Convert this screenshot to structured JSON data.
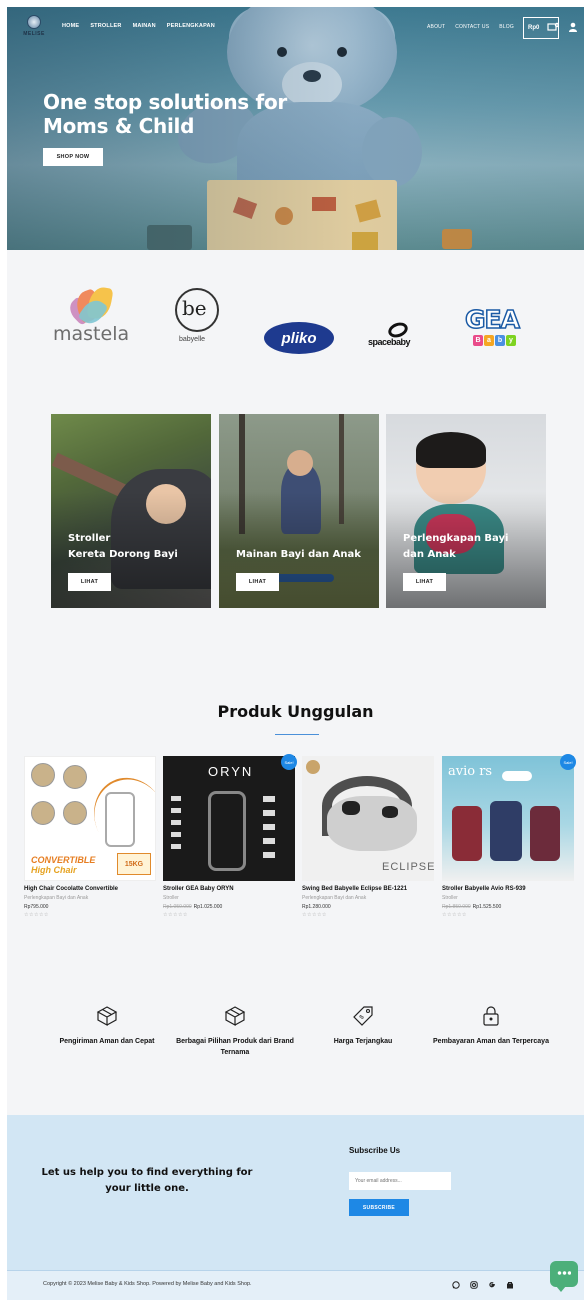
{
  "nav": {
    "logo_text": "MELISE",
    "left_items": [
      "HOME",
      "STROLLER",
      "MAINAN",
      "PERLENGKAPAN"
    ],
    "right_items": [
      "ABOUT",
      "CONTACT US",
      "BLOG"
    ],
    "cart_total": "Rp0",
    "cart_count": "0",
    "icons": [
      "cart-icon",
      "user-icon"
    ]
  },
  "hero": {
    "title": "One stop solutions for Moms & Child",
    "button": "SHOP NOW"
  },
  "brands": {
    "mastela": "mastela",
    "babyelle_mark": "be",
    "babyelle": "babyelle",
    "pliko": "pliko",
    "spacebaby": "spacebaby",
    "gea": "GEA",
    "gea_baby": [
      "B",
      "a",
      "b",
      "y"
    ]
  },
  "categories": [
    {
      "title": "Stroller\nKereta Dorong Bayi",
      "button": "LIHAT"
    },
    {
      "title": "Mainan Bayi dan Anak",
      "button": "LIHAT"
    },
    {
      "title": "Perlengkapan Bayi dan Anak",
      "button": "LIHAT"
    }
  ],
  "featured": {
    "title": "Produk Unggulan",
    "products": [
      {
        "name": "High Chair Cocolatte Convertible",
        "category": "Perlengkapan Bayi dan Anak",
        "old_price": "",
        "price": "Rp795.000",
        "stars": "☆☆☆☆☆",
        "sale": "",
        "image_text": [
          "CONVERTIBLE",
          "High Chair",
          "15KG"
        ]
      },
      {
        "name": "Stroller GEA Baby ORYN",
        "category": "Stroller",
        "old_price": "Rp1.050.000",
        "price": "Rp1.025.000",
        "stars": "☆☆☆☆☆",
        "sale": "Sale!",
        "image_text": [
          "ORYN"
        ]
      },
      {
        "name": "Swing Bed Babyelle Eclipse BE-1221",
        "category": "Perlengkapan Bayi dan Anak",
        "old_price": "",
        "price": "Rp1.280.000",
        "stars": "☆☆☆☆☆",
        "sale": "",
        "image_text": [
          "ECLIPSE"
        ]
      },
      {
        "name": "Stroller Babyelle Avio RS-939",
        "category": "Stroller",
        "old_price": "Rp1.850.000",
        "price": "Rp1.525.500",
        "stars": "☆☆☆☆☆",
        "sale": "Sale!",
        "image_text": [
          "avio rs"
        ]
      }
    ]
  },
  "features": [
    {
      "icon": "box-icon",
      "label": "Pengiriman Aman dan Cepat"
    },
    {
      "icon": "box-icon",
      "label": "Berbagai Pilihan Produk dari Brand Ternama"
    },
    {
      "icon": "price-tag-icon",
      "label": "Harga Terjangkau"
    },
    {
      "icon": "lock-icon",
      "label": "Pembayaran Aman dan Terpercaya"
    }
  ],
  "subscribe": {
    "lead": "Let us help you to find everything for your little one.",
    "title": "Subscribe Us",
    "placeholder": "Your email address...",
    "button": "SUBSCRIBE"
  },
  "footer": {
    "copyright": "Copyright © 2023 Melise Baby & Kids Shop. Powered by Melise Baby and Kids Shop.",
    "social_icons": [
      "whatsapp-icon",
      "instagram-icon",
      "google-icon",
      "shop-icon"
    ],
    "chat_icon": "chat-icon"
  },
  "colors": {
    "accent": "#1e88e5",
    "subscribe_bg": "#d2e6f4"
  }
}
